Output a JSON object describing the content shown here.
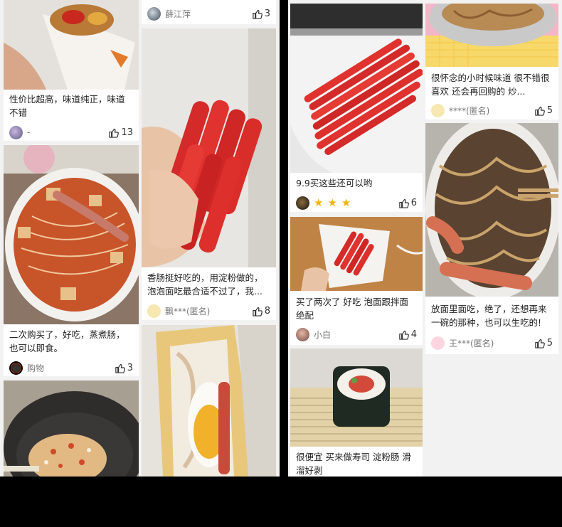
{
  "left_panel": {
    "col1": [
      {
        "caption": "性价比超高，味道纯正，味道不错",
        "user": "-",
        "likes": "13",
        "avatar": "photo-avatar"
      },
      {
        "caption": "二次购买了，好吃，蒸煮肠，也可以即食。",
        "user": "购物",
        "likes": "3",
        "avatar": "dark-avatar"
      },
      {
        "caption": "",
        "user": "",
        "likes": "",
        "avatar": ""
      }
    ],
    "col2": [
      {
        "caption": "",
        "user": "薛江萍",
        "likes": "3",
        "avatar": "photo-avatar"
      },
      {
        "caption": "香肠挺好吃的，用淀粉做的，泡泡面吃最合适不过了，我...",
        "user": "飘***(匿名)",
        "likes": "8",
        "avatar": "yellow-anon-avatar"
      },
      {
        "caption": "",
        "user": "",
        "likes": "",
        "avatar": ""
      }
    ]
  },
  "right_panel": {
    "col1": [
      {
        "caption": "9.9买这些还可以哟",
        "user": "",
        "likes": "6",
        "avatar": "photo-avatar",
        "stars": [
          "★",
          "★",
          "★"
        ]
      },
      {
        "caption": "买了两次了 好吃 泡面跟拌面绝配",
        "user": "小白",
        "likes": "4",
        "avatar": "photo-avatar"
      },
      {
        "caption": "很便宜 买来做寿司 淀粉肠 滑溜好剥",
        "user": "",
        "likes": "",
        "avatar": ""
      }
    ],
    "col2": [
      {
        "caption": "很怀念的小时候味道 很不错很喜欢 还会再回购的 炒...",
        "user": "****(匿名)",
        "likes": "5",
        "avatar": "yellow-anon-avatar"
      },
      {
        "caption": "放面里面吃，绝了，还想再来一碗的那种，也可以生吃的!",
        "user": "王***(匿名)",
        "likes": "5",
        "avatar": "pink-anon-avatar"
      }
    ]
  },
  "colors": {
    "star": "#f0b400",
    "card": "#ffffff",
    "background": "#f2f2f2",
    "frame": "#000000"
  }
}
